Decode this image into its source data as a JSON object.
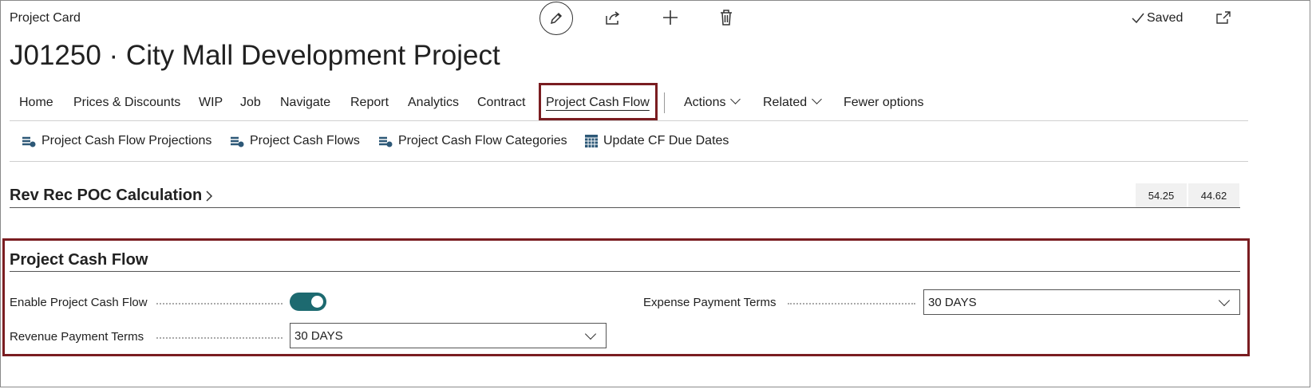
{
  "header": {
    "page_label": "Project Card",
    "title": "J01250 · City Mall Development Project",
    "saved_label": "Saved"
  },
  "nav": {
    "items": [
      "Home",
      "Prices & Discounts",
      "WIP",
      "Job",
      "Navigate",
      "Report",
      "Analytics",
      "Contract",
      "Project Cash Flow"
    ],
    "actions": "Actions",
    "related": "Related",
    "fewer": "Fewer options"
  },
  "actionbar": {
    "items": [
      "Project Cash Flow Projections",
      "Project Cash Flows",
      "Project Cash Flow Categories",
      "Update CF Due Dates"
    ]
  },
  "rev_rec": {
    "title": "Rev Rec POC Calculation",
    "values": [
      "54.25",
      "44.62"
    ]
  },
  "cash_flow": {
    "title": "Project Cash Flow",
    "enable_label": "Enable Project Cash Flow",
    "enabled": true,
    "revenue_label": "Revenue Payment Terms",
    "revenue_value": "30 DAYS",
    "expense_label": "Expense Payment Terms",
    "expense_value": "30 DAYS"
  },
  "colors": {
    "accent_border": "#7a1d21",
    "toggle_on": "#1d6a70"
  }
}
